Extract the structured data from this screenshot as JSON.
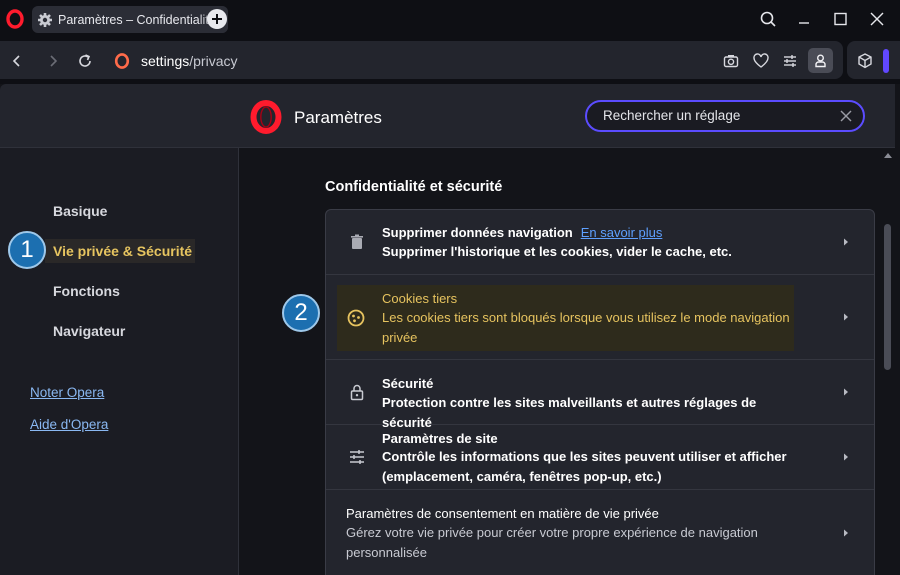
{
  "tab": {
    "title": "Paramètres – Confidentialité et sécurité"
  },
  "address": {
    "host": "settings",
    "path": "/privacy"
  },
  "settings": {
    "title": "Paramètres",
    "search_placeholder": "Rechercher un réglage"
  },
  "sidebar": {
    "items": [
      {
        "label": "Basique"
      },
      {
        "label": "Vie privée & Sécurité"
      },
      {
        "label": "Fonctions"
      },
      {
        "label": "Navigateur"
      }
    ],
    "links": [
      {
        "label": "Noter Opera"
      },
      {
        "label": "Aide d'Opera"
      }
    ]
  },
  "badges": {
    "one": "1",
    "two": "2"
  },
  "main": {
    "section_title": "Confidentialité et sécurité",
    "rows": [
      {
        "title": "Supprimer données navigation",
        "link": "En savoir plus",
        "desc": "Supprimer l'historique et les cookies, vider le cache, etc."
      },
      {
        "title": "Cookies tiers",
        "desc": "Les cookies tiers sont bloqués lorsque vous utilisez le mode navigation privée"
      },
      {
        "title": "Sécurité",
        "desc": "Protection contre les sites malveillants et autres réglages de sécurité"
      },
      {
        "title": "Paramètres de site",
        "desc": "Contrôle les informations que les sites peuvent utiliser et afficher (emplacement, caméra, fenêtres pop-up, etc.)"
      },
      {
        "title": "Paramètres de consentement en matière de vie privée",
        "desc": "Gérez votre vie privée pour créer votre propre expérience de navigation personnalisée"
      }
    ]
  },
  "colors": {
    "accent": "#e7c560",
    "link": "#8ab8f2",
    "focus": "#5b4cff",
    "badge": "#1c6fb0"
  }
}
